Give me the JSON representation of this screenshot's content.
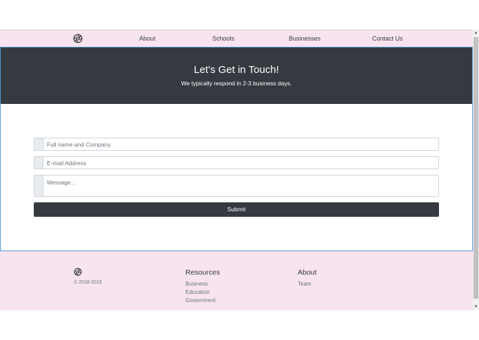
{
  "nav": {
    "logo_icon": "aperture-icon",
    "links": [
      "About",
      "Schools",
      "Businesses",
      "Contact Us"
    ]
  },
  "hero": {
    "title": "Let's Get in Touch!",
    "subtitle": "We typically respond in 2-3 business days."
  },
  "form": {
    "name_placeholder": "Full name and Company",
    "email_placeholder": "E-mail Address",
    "message_placeholder": "Message...",
    "submit_label": "Submit"
  },
  "footer": {
    "logo_icon": "aperture-icon",
    "copyright": "© 2018-2019",
    "resources": {
      "heading": "Resources",
      "links": [
        "Business",
        "Education",
        "Government"
      ]
    },
    "about": {
      "heading": "About",
      "links": [
        "Team"
      ]
    }
  },
  "colors": {
    "brand_pink": "#f7e4ee",
    "dark": "#343a40",
    "frame_blue": "#5b9bd5"
  }
}
